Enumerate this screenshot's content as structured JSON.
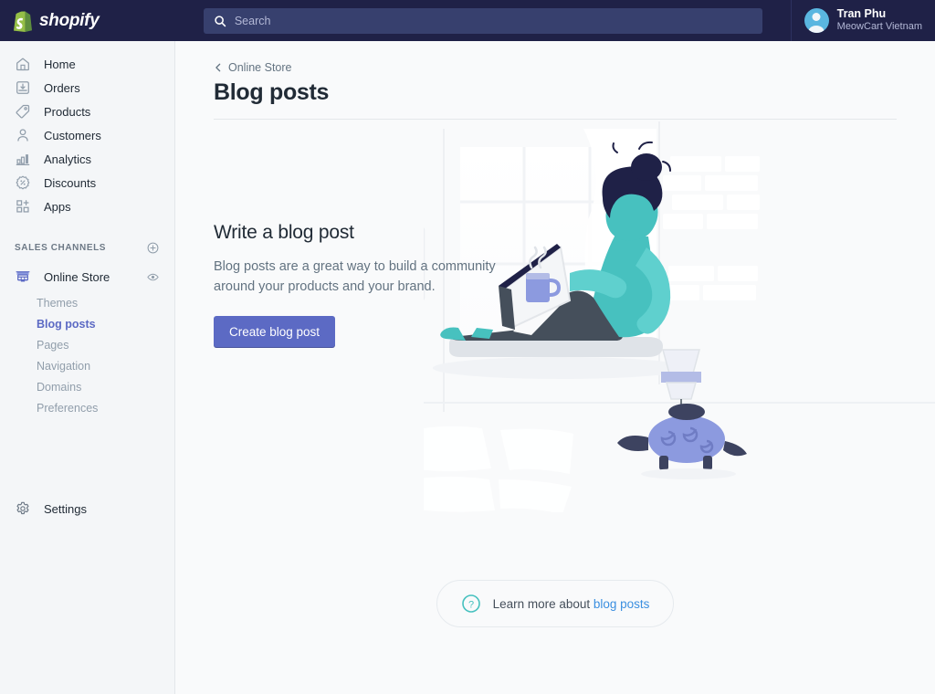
{
  "topbar": {
    "logo_text": "shopify",
    "search": {
      "placeholder": "Search",
      "value": ""
    },
    "user": {
      "name": "Tran Phu",
      "store": "MeowCart Vietnam"
    }
  },
  "sidebar": {
    "items": [
      {
        "label": "Home",
        "icon": "home-icon"
      },
      {
        "label": "Orders",
        "icon": "orders-icon"
      },
      {
        "label": "Products",
        "icon": "products-tag-icon"
      },
      {
        "label": "Customers",
        "icon": "customers-person-icon"
      },
      {
        "label": "Analytics",
        "icon": "analytics-bar-chart-icon"
      },
      {
        "label": "Discounts",
        "icon": "discounts-percent-icon"
      },
      {
        "label": "Apps",
        "icon": "apps-grid-icon"
      }
    ],
    "sales_channels": {
      "title": "SALES CHANNELS",
      "add_icon": "plus-circle-icon",
      "channel": {
        "label": "Online Store",
        "icon": "online-store-icon",
        "view_icon": "eye-icon"
      },
      "subitems": [
        {
          "label": "Themes",
          "active": false
        },
        {
          "label": "Blog posts",
          "active": true
        },
        {
          "label": "Pages",
          "active": false
        },
        {
          "label": "Navigation",
          "active": false
        },
        {
          "label": "Domains",
          "active": false
        },
        {
          "label": "Preferences",
          "active": false
        }
      ]
    },
    "settings": {
      "label": "Settings",
      "icon": "gear-icon"
    }
  },
  "page": {
    "breadcrumb": "Online Store",
    "breadcrumb_icon": "chevron-left-icon",
    "title": "Blog posts"
  },
  "empty_state": {
    "heading": "Write a blog post",
    "body": "Blog posts are a great way to build a community around your products and your brand.",
    "cta_label": "Create blog post",
    "illustration": "person-with-laptop-on-windowsill-illustration"
  },
  "footer": {
    "help_icon": "question-circle-icon",
    "help_text": "Learn more about ",
    "help_link": "blog posts"
  },
  "colors": {
    "topbar_bg": "#1f2147",
    "search_bg": "#37406e",
    "sidebar_bg": "#f4f6f8",
    "main_bg": "#f9fafb",
    "accent_indigo": "#5c6ac4",
    "brand_green": "#95bf47",
    "teal": "#47c1bf",
    "link_blue": "#3b8fe0",
    "text_dark": "#212b36",
    "text_muted": "#637381",
    "text_subdued": "#919eab"
  }
}
